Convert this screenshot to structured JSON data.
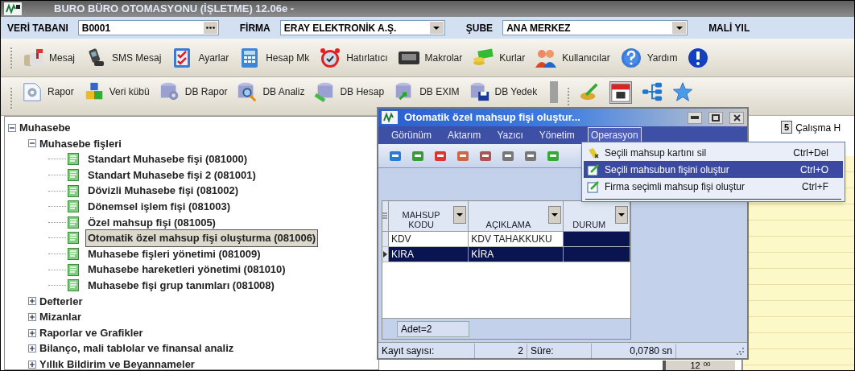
{
  "window": {
    "title": "BURO BÜRO OTOMASYONU (İŞLETME) 12.06e -"
  },
  "db_bar": [
    {
      "label": "VERİ TABANI",
      "value": "B0001",
      "kind": "browse"
    },
    {
      "label": "FİRMA",
      "value": "ERAY ELEKTRONİK A.Ş.",
      "kind": "dropdown"
    },
    {
      "label": "ŞUBE",
      "value": "ANA MERKEZ",
      "kind": "dropdown"
    },
    {
      "label": "MALİ YIL",
      "kind": "label"
    }
  ],
  "toolbar_1": [
    "Mesaj",
    "SMS Mesaj",
    "Ayarlar",
    "Hesap Mk",
    "Hatırlatıcı",
    "Makrolar",
    "Kurlar",
    "Kullanıcılar",
    "Yardım"
  ],
  "toolbar_2": [
    "Rapor",
    "Veri kübü",
    "DB Rapor",
    "DB Analiz",
    "DB Hesap",
    "DB EXIM",
    "DB Yedek"
  ],
  "tree": [
    {
      "label": "Muhasebe",
      "expanded": true,
      "children": [
        {
          "label": "Muhasebe fişleri",
          "expanded": true,
          "children": [
            {
              "label": "Standart Muhasebe fişi (081000)",
              "selected": false
            },
            {
              "label": "Standart Muhasebe fişi 2 (081001)",
              "selected": false
            },
            {
              "label": "Dövizli Muhasebe fişi (081002)",
              "selected": false
            },
            {
              "label": "Dönemsel işlem fişi (081003)",
              "selected": false
            },
            {
              "label": "Özel mahsup fişi (081005)",
              "selected": false
            },
            {
              "label": "Otomatik özel mahsup fişi oluşturma (081006)",
              "selected": true
            },
            {
              "label": "Muhasebe fişleri yönetimi (081009)",
              "selected": false
            },
            {
              "label": "Muhasebe hareketleri yönetimi (081010)",
              "selected": false
            },
            {
              "label": "Muhasebe fişi grup tanımları (081008)",
              "selected": false
            }
          ]
        },
        {
          "label": "Defterler",
          "expanded": false
        },
        {
          "label": "Mizanlar",
          "expanded": false
        },
        {
          "label": "Raporlar ve Grafikler",
          "expanded": false
        },
        {
          "label": "Bilanço, mali tablolar ve finansal analiz",
          "expanded": false
        },
        {
          "label": "Yıllık Bildirim ve Beyannameler",
          "expanded": false
        }
      ]
    }
  ],
  "right_panel": {
    "badge": "5",
    "label": "Çalışma H",
    "clock_hour": "12",
    "clock_minute": "00"
  },
  "child_window": {
    "title": "Otomatik özel mahsup fişi oluştur...",
    "menu": [
      {
        "label": "Görünüm",
        "selected": false
      },
      {
        "label": "Aktarım",
        "selected": false
      },
      {
        "label": "Yazıcı",
        "selected": false
      },
      {
        "label": "Yönetim",
        "selected": false
      },
      {
        "label": "Operasyon",
        "selected": true
      }
    ],
    "dropdown": [
      {
        "label": "Seçili mahsup kartını sil",
        "shortcut": "Ctrl+Del",
        "selected": false
      },
      {
        "label": "Seçili mahsubun fişini oluştur",
        "shortcut": "Ctrl+O",
        "selected": true
      },
      {
        "label": "Firma seçimli mahsup fişi oluştur",
        "shortcut": "Ctrl+F",
        "selected": false
      }
    ],
    "grid": {
      "columns": [
        {
          "line_1": "MAHSUP",
          "line_2": "KODU"
        },
        {
          "line_2": "AÇIKLAMA"
        },
        {
          "line_2": "DURUM"
        }
      ],
      "rows": [
        {
          "selected": false,
          "cells": [
            {
              "text": "KDV",
              "highlighted": false
            },
            {
              "text": "KDV TAHAKKUKU",
              "highlighted": false
            },
            {
              "highlighted": true
            }
          ]
        },
        {
          "selected": true,
          "cells": [
            {
              "text": "KIRA",
              "highlighted": true
            },
            {
              "text": "KİRA",
              "highlighted": true
            },
            {
              "highlighted": true
            }
          ]
        }
      ],
      "footer": "Adet=2"
    },
    "status_bar": {
      "count_label": "Kayıt sayısı:",
      "count": "2",
      "time_label": "Süre:",
      "time": "0,0780 sn"
    }
  }
}
